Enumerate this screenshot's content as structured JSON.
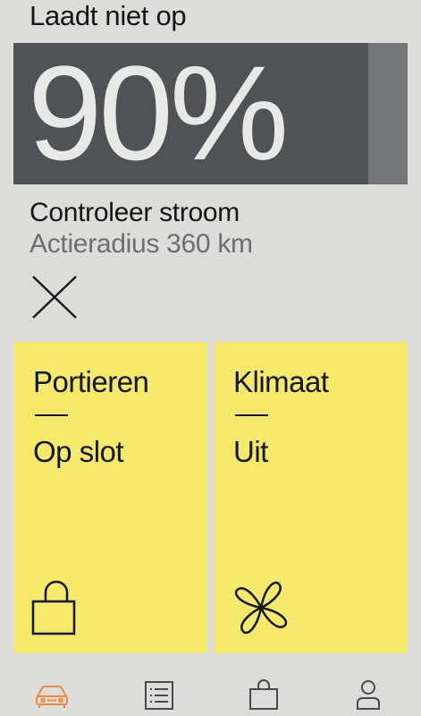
{
  "header": {
    "charge_status": "Laadt niet op"
  },
  "battery": {
    "percent_label": "90%",
    "level_percent": 90
  },
  "info": {
    "check_power": "Controleer stroom",
    "range": "Actieradius 360 km"
  },
  "tiles": [
    {
      "title": "Portieren",
      "status": "Op slot",
      "icon": "lock-icon"
    },
    {
      "title": "Klimaat",
      "status": "Uit",
      "icon": "fan-icon"
    }
  ],
  "nav": {
    "items": [
      {
        "icon": "car-icon",
        "active": true
      },
      {
        "icon": "list-icon",
        "active": false
      },
      {
        "icon": "shopping-bag-icon",
        "active": false
      },
      {
        "icon": "profile-icon",
        "active": false
      }
    ],
    "active_color": "#f08a3c",
    "inactive_color": "#4a4a4a"
  },
  "colors": {
    "background": "#dcdcda",
    "tile": "#f4e96a",
    "battery_fill": "#505356",
    "battery_empty": "#737576"
  }
}
